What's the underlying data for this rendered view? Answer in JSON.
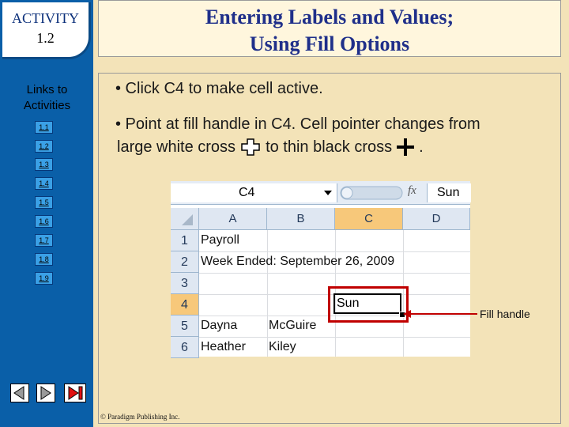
{
  "sidebar": {
    "activity_label": "ACTIVITY",
    "activity_number": "1.2",
    "links_title": "Links to Activities",
    "links": [
      "1.1",
      "1.2",
      "1.3",
      "1.4",
      "1.5",
      "1.6",
      "1.7",
      "1.8",
      "1.9"
    ]
  },
  "slide": {
    "title_line1": "Entering Labels and Values;",
    "title_line2": "Using Fill Options",
    "bullet1": "• Click C4 to make cell active.",
    "bullet2_line1": "• Point at fill handle in C4. Cell pointer changes from",
    "bullet2_line2a": "large white cross",
    "bullet2_line2b": "to thin black cross",
    "bullet2_line2c": ".",
    "fill_handle_label": "Fill handle",
    "copyright": "© Paradigm Publishing Inc."
  },
  "excel": {
    "name_box": "C4",
    "fx_label": "fx",
    "formula_value": "Sun",
    "columns": [
      "A",
      "B",
      "C",
      "D"
    ],
    "rows": [
      "1",
      "2",
      "3",
      "4",
      "5",
      "6"
    ],
    "cells": {
      "A1": "Payroll",
      "A2": "Week Ended: September 26, 2009",
      "C4": "Sun",
      "A5": "Dayna",
      "B5": "McGuire",
      "A6": "Heather",
      "B6": "Kiley"
    }
  },
  "colors": {
    "sidebar": "#0a5fa8",
    "title": "#1f2f8a",
    "highlight": "#c00000",
    "link_button": "#3aa0e6"
  }
}
